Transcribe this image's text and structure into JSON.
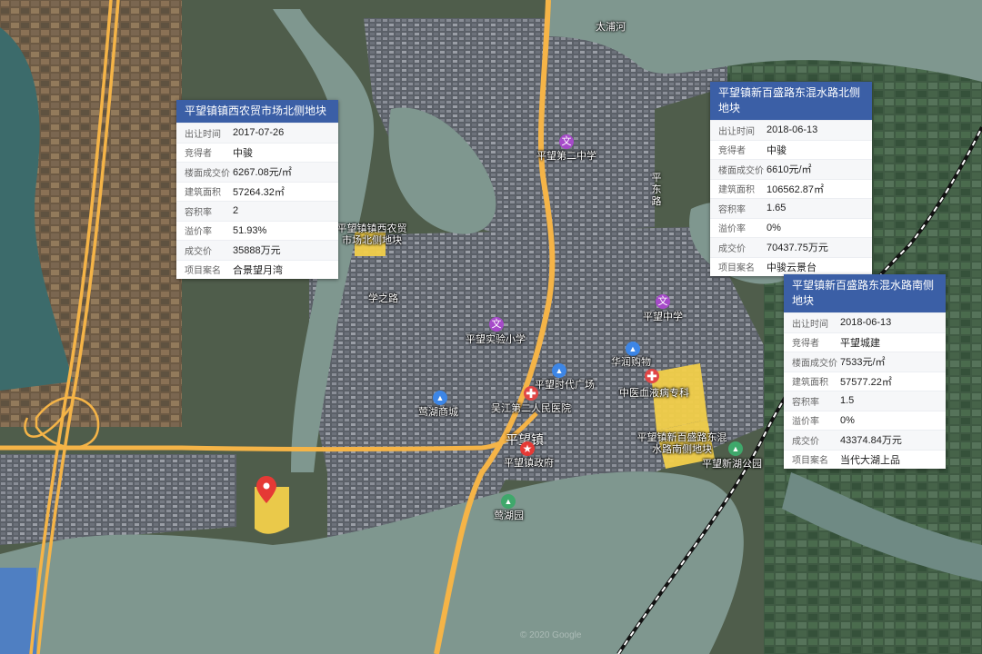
{
  "map_labels": {
    "river_taipu": "太浦河",
    "road_xuezhi": "学之路",
    "road_pingdong": "平东路",
    "town_name": "平望镇",
    "copyright": "© 2020 Google"
  },
  "pois": [
    {
      "type": "edu",
      "glyph": "文",
      "label": "平望第二中学"
    },
    {
      "type": "edu",
      "glyph": "文",
      "label": "平望实验小学"
    },
    {
      "type": "edu",
      "glyph": "文",
      "label": "平望中学"
    },
    {
      "type": "shop",
      "glyph": "▲",
      "label": "华润购物"
    },
    {
      "type": "shop",
      "glyph": "▲",
      "label": "平望时代广场"
    },
    {
      "type": "shop",
      "glyph": "▲",
      "label": "莺湖商城"
    },
    {
      "type": "hosp",
      "glyph": "✚",
      "label": "吴江第二人民医院"
    },
    {
      "type": "hosp",
      "glyph": "✚",
      "label": "中医血液病专科"
    },
    {
      "type": "park",
      "glyph": "▲",
      "label": "莺湖园"
    },
    {
      "type": "park",
      "glyph": "▲",
      "label": "平望新湖公园"
    },
    {
      "type": "gov",
      "glyph": "★",
      "label": "平望镇政府"
    }
  ],
  "plot_labels": {
    "plot_west": "平望镇镇西农贸市场北侧地块",
    "plot_south": "平望镇新百盛路东混水路南侧地块"
  },
  "cards": [
    {
      "title": "平望镇镇西农贸市场北侧地块",
      "rows": [
        {
          "key": "出让时间",
          "value": "2017-07-26"
        },
        {
          "key": "竞得者",
          "value": "中骏"
        },
        {
          "key": "楼面成交价",
          "value": "6267.08元/㎡"
        },
        {
          "key": "建筑面积",
          "value": "57264.32㎡"
        },
        {
          "key": "容积率",
          "value": "2"
        },
        {
          "key": "溢价率",
          "value": "51.93%"
        },
        {
          "key": "成交价",
          "value": "35888万元"
        },
        {
          "key": "项目案名",
          "value": "合景望月湾"
        }
      ]
    },
    {
      "title": "平望镇新百盛路东混水路北侧地块",
      "rows": [
        {
          "key": "出让时间",
          "value": "2018-06-13"
        },
        {
          "key": "竞得者",
          "value": "中骏"
        },
        {
          "key": "楼面成交价",
          "value": "6610元/㎡"
        },
        {
          "key": "建筑面积",
          "value": "106562.87㎡"
        },
        {
          "key": "容积率",
          "value": "1.65"
        },
        {
          "key": "溢价率",
          "value": "0%"
        },
        {
          "key": "成交价",
          "value": "70437.75万元"
        },
        {
          "key": "项目案名",
          "value": "中骏云景台"
        }
      ]
    },
    {
      "title": "平望镇新百盛路东混水路南侧地块",
      "rows": [
        {
          "key": "出让时间",
          "value": "2018-06-13"
        },
        {
          "key": "竞得者",
          "value": "平望城建"
        },
        {
          "key": "楼面成交价",
          "value": "7533元/㎡"
        },
        {
          "key": "建筑面积",
          "value": "57577.22㎡"
        },
        {
          "key": "容积率",
          "value": "1.5"
        },
        {
          "key": "溢价率",
          "value": "0%"
        },
        {
          "key": "成交价",
          "value": "43374.84万元"
        },
        {
          "key": "项目案名",
          "value": "当代大湖上品"
        }
      ]
    }
  ],
  "colors": {
    "card_header": "#3b5fa6",
    "road_main": "#f5b447",
    "plot_fill": "#f2cf4a",
    "water": "#7f978f",
    "land": "#4f5d4b"
  }
}
